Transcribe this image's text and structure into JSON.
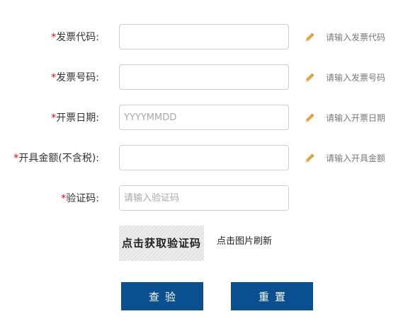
{
  "form": {
    "fields": [
      {
        "label": "发票代码:",
        "value": "",
        "placeholder": "",
        "hint": "请输入发票代码"
      },
      {
        "label": "发票号码:",
        "value": "",
        "placeholder": "",
        "hint": "请输入发票号码"
      },
      {
        "label": "开票日期:",
        "value": "",
        "placeholder": "YYYYMMDD",
        "hint": "请输入开票日期"
      },
      {
        "label": "开具金额(不含税):",
        "value": "",
        "placeholder": "",
        "hint": "请输入开具金额"
      },
      {
        "label": "验证码:",
        "value": "",
        "placeholder": "请输入验证码",
        "hint": ""
      }
    ],
    "required_mark": "*",
    "captcha_text": "点击获取验证码",
    "refresh_text": "点击图片刷新",
    "query_button": "查验",
    "reset_button": "重置"
  },
  "colors": {
    "required": "#e60012",
    "button_bg": "#0a4f8f",
    "pencil": "#e8a33c"
  },
  "icons": {
    "hint": "pencil-icon"
  }
}
